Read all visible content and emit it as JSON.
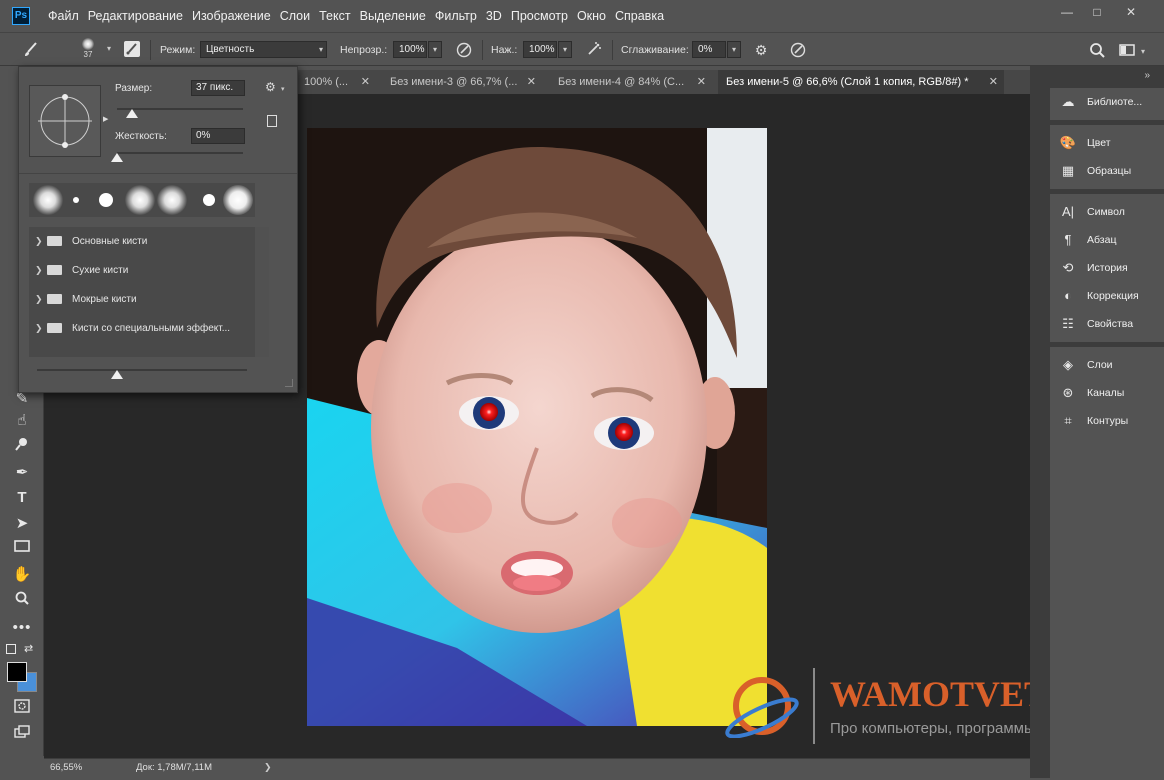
{
  "app": {
    "logo": "Ps"
  },
  "menu": [
    "Файл",
    "Редактирование",
    "Изображение",
    "Слои",
    "Текст",
    "Выделение",
    "Фильтр",
    "3D",
    "Просмотр",
    "Окно",
    "Справка"
  ],
  "window_controls": [
    "—",
    "□",
    "✕"
  ],
  "options": {
    "brush_size": "37",
    "mode_label": "Режим:",
    "mode_value": "Цветность",
    "opacity_label": "Непрозр.:",
    "opacity_value": "100%",
    "pressure_label": "Наж.:",
    "pressure_value": "100%",
    "smoothing_label": "Сглаживание:",
    "smoothing_value": "0%"
  },
  "tabs": [
    {
      "label": "100% (...",
      "active": false
    },
    {
      "label": "Без имени-3 @ 66,7% (...",
      "active": false
    },
    {
      "label": "Без имени-4 @ 84% (С...",
      "active": false
    },
    {
      "label": "Без имени-5 @ 66,6% (Слой 1 копия, RGB/8#) *",
      "active": true
    }
  ],
  "tab_overflow": "»",
  "brush_panel": {
    "size_label": "Размер:",
    "size_value": "37 пикс.",
    "hardness_label": "Жесткость:",
    "hardness_value": "0%",
    "size_fraction": 0.12,
    "hardness_fraction": 0.0,
    "preview_fraction": 0.38,
    "folders": [
      "Основные кисти",
      "Сухие кисти",
      "Мокрые кисти",
      "Кисти со специальными эффект..."
    ]
  },
  "right_panel": {
    "groups": [
      [
        {
          "label": "Библиоте...",
          "icon": "cloud-icon"
        }
      ],
      [
        {
          "label": "Цвет",
          "icon": "palette-icon"
        },
        {
          "label": "Образцы",
          "icon": "grid-icon"
        }
      ],
      [
        {
          "label": "Символ",
          "icon": "character-icon"
        },
        {
          "label": "Абзац",
          "icon": "paragraph-icon"
        },
        {
          "label": "История",
          "icon": "history-icon"
        },
        {
          "label": "Коррекция",
          "icon": "adjustment-icon"
        },
        {
          "label": "Свойства",
          "icon": "properties-icon"
        }
      ],
      [
        {
          "label": "Слои",
          "icon": "layers-icon"
        },
        {
          "label": "Каналы",
          "icon": "channels-icon"
        },
        {
          "label": "Контуры",
          "icon": "paths-icon"
        }
      ]
    ]
  },
  "status": {
    "zoom": "66,55%",
    "doc": "Док: 1,78M/7,11M",
    "arrow": "❯"
  },
  "watermark": {
    "title": "WAMOTVET.RU",
    "subtitle": "Про компьютеры, программы и сайты"
  },
  "colors": {
    "foreground": "#000000",
    "background": "#4a90d9",
    "watermark_accent": "#d9602a"
  }
}
